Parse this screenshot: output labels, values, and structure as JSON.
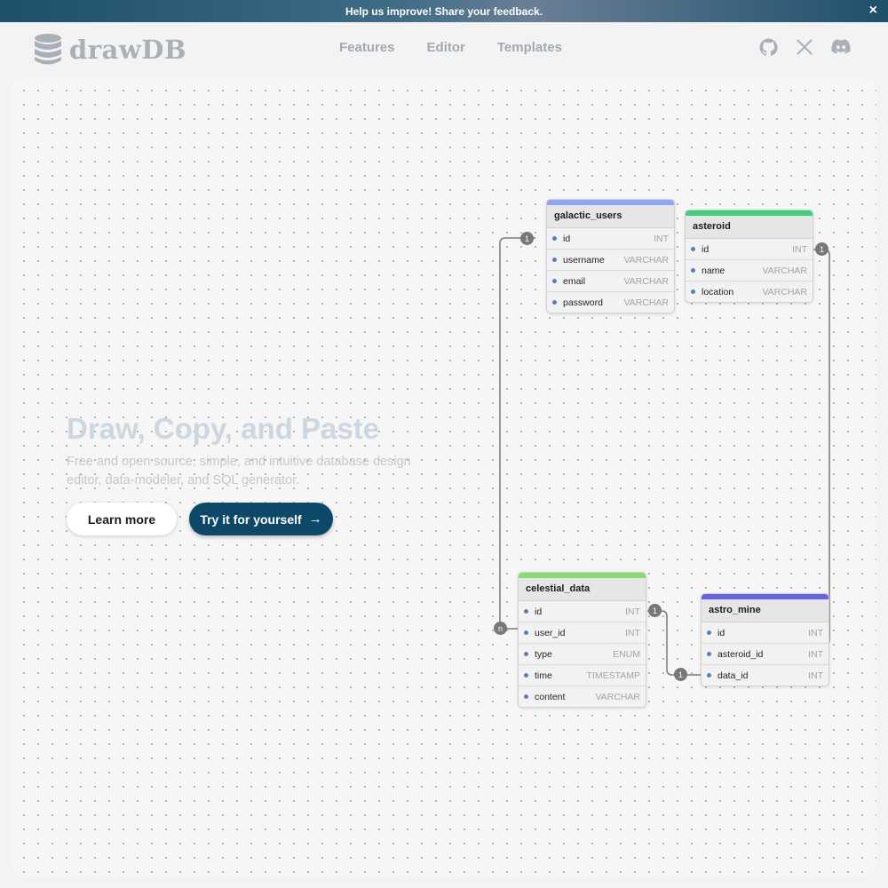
{
  "banner": {
    "text": "Help us improve! Share your feedback.",
    "close": "×"
  },
  "brand": {
    "name": "drawDB",
    "logo_icon": "database-icon"
  },
  "nav": {
    "links": [
      "Features",
      "Editor",
      "Templates"
    ]
  },
  "social": {
    "icons": [
      "github-icon",
      "x-icon",
      "discord-icon"
    ]
  },
  "hero": {
    "title": "Draw, Copy, and Paste",
    "subtitle": "Free and open source, simple, and intuitive database design editor, data-modeler, and SQL generator.",
    "learn_more": "Learn more",
    "try_it": "Try it for yourself",
    "try_arrow": "→"
  },
  "colors": {
    "brand_dark": "#0e4868",
    "galactic_users": "#8fa5f5",
    "asteroid": "#3ed07a",
    "celestial_data": "#86dd6d",
    "astro_mine": "#6763e8"
  },
  "tables": {
    "galactic_users": {
      "name": "galactic_users",
      "fields": [
        {
          "name": "id",
          "type": "INT"
        },
        {
          "name": "username",
          "type": "VARCHAR"
        },
        {
          "name": "email",
          "type": "VARCHAR"
        },
        {
          "name": "password",
          "type": "VARCHAR"
        }
      ]
    },
    "asteroid": {
      "name": "asteroid",
      "fields": [
        {
          "name": "id",
          "type": "INT"
        },
        {
          "name": "name",
          "type": "VARCHAR"
        },
        {
          "name": "location",
          "type": "VARCHAR"
        }
      ]
    },
    "celestial_data": {
      "name": "celestial_data",
      "fields": [
        {
          "name": "id",
          "type": "INT"
        },
        {
          "name": "user_id",
          "type": "INT"
        },
        {
          "name": "type",
          "type": "ENUM"
        },
        {
          "name": "time",
          "type": "TIMESTAMP"
        },
        {
          "name": "content",
          "type": "VARCHAR"
        }
      ]
    },
    "astro_mine": {
      "name": "astro_mine",
      "fields": [
        {
          "name": "id",
          "type": "INT"
        },
        {
          "name": "asteroid_id",
          "type": "INT"
        },
        {
          "name": "data_id",
          "type": "INT"
        }
      ]
    }
  },
  "relations": {
    "users_one": "1",
    "users_many": "n",
    "asteroid_one": "1",
    "data_one": "1",
    "mine_one": "1"
  }
}
